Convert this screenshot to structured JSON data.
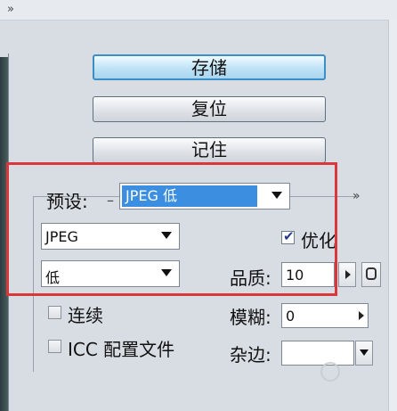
{
  "top": {
    "chevron": "»"
  },
  "buttons": {
    "save": "存储",
    "reset": "复位",
    "remember": "记住"
  },
  "preset": {
    "label": "预设:",
    "value": "JPEG 低",
    "more": "»"
  },
  "format": {
    "value": "JPEG"
  },
  "optimize": {
    "label": "优化",
    "checked": true
  },
  "compression": {
    "value": "低"
  },
  "quality": {
    "label": "品质:",
    "value": "10"
  },
  "continuous": {
    "label": "连续",
    "checked": false
  },
  "blur": {
    "label": "模糊:",
    "value": "0"
  },
  "icc": {
    "label": "ICC 配置文件",
    "checked": false
  },
  "matte": {
    "label": "杂边:",
    "value": ""
  },
  "colors": {
    "red_annotation": "#d9373a",
    "selection": "#3b8ee0",
    "primary_border": "#3b8ec6"
  }
}
